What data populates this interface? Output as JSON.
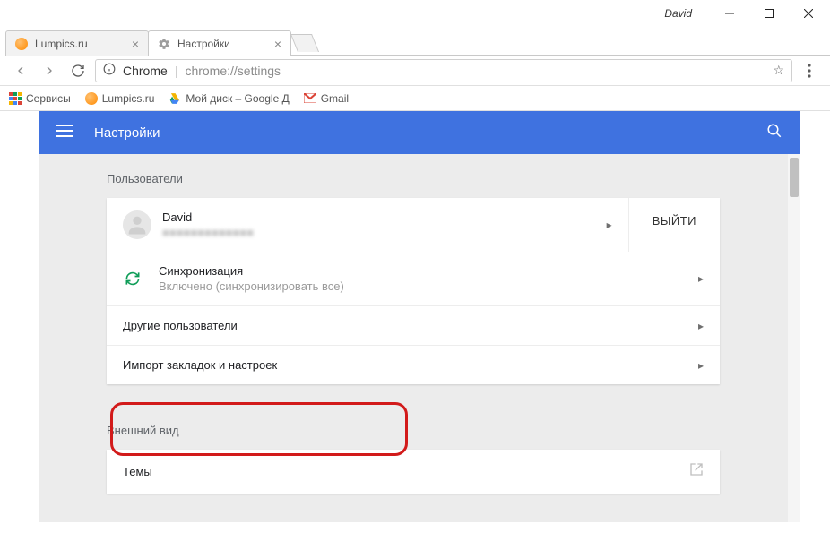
{
  "titlebar": {
    "username": "David"
  },
  "tabs": [
    {
      "title": "Lumpics.ru"
    },
    {
      "title": "Настройки"
    }
  ],
  "omnibox": {
    "origin": "Chrome",
    "path": "chrome://settings"
  },
  "bookmarks": {
    "apps": "Сервисы",
    "lumpics": "Lumpics.ru",
    "drive": "Мой диск – Google Д",
    "gmail": "Gmail"
  },
  "header": {
    "title": "Настройки"
  },
  "sections": {
    "users_title": "Пользователи",
    "account_name": "David",
    "account_email": "■■■■■■■■■■■■■",
    "signout": "ВЫЙТИ",
    "sync_title": "Синхронизация",
    "sync_sub": "Включено (синхронизировать все)",
    "other_users": "Другие пользователи",
    "import": "Импорт закладок и настроек",
    "appearance_title": "Внешний вид",
    "themes": "Темы"
  }
}
